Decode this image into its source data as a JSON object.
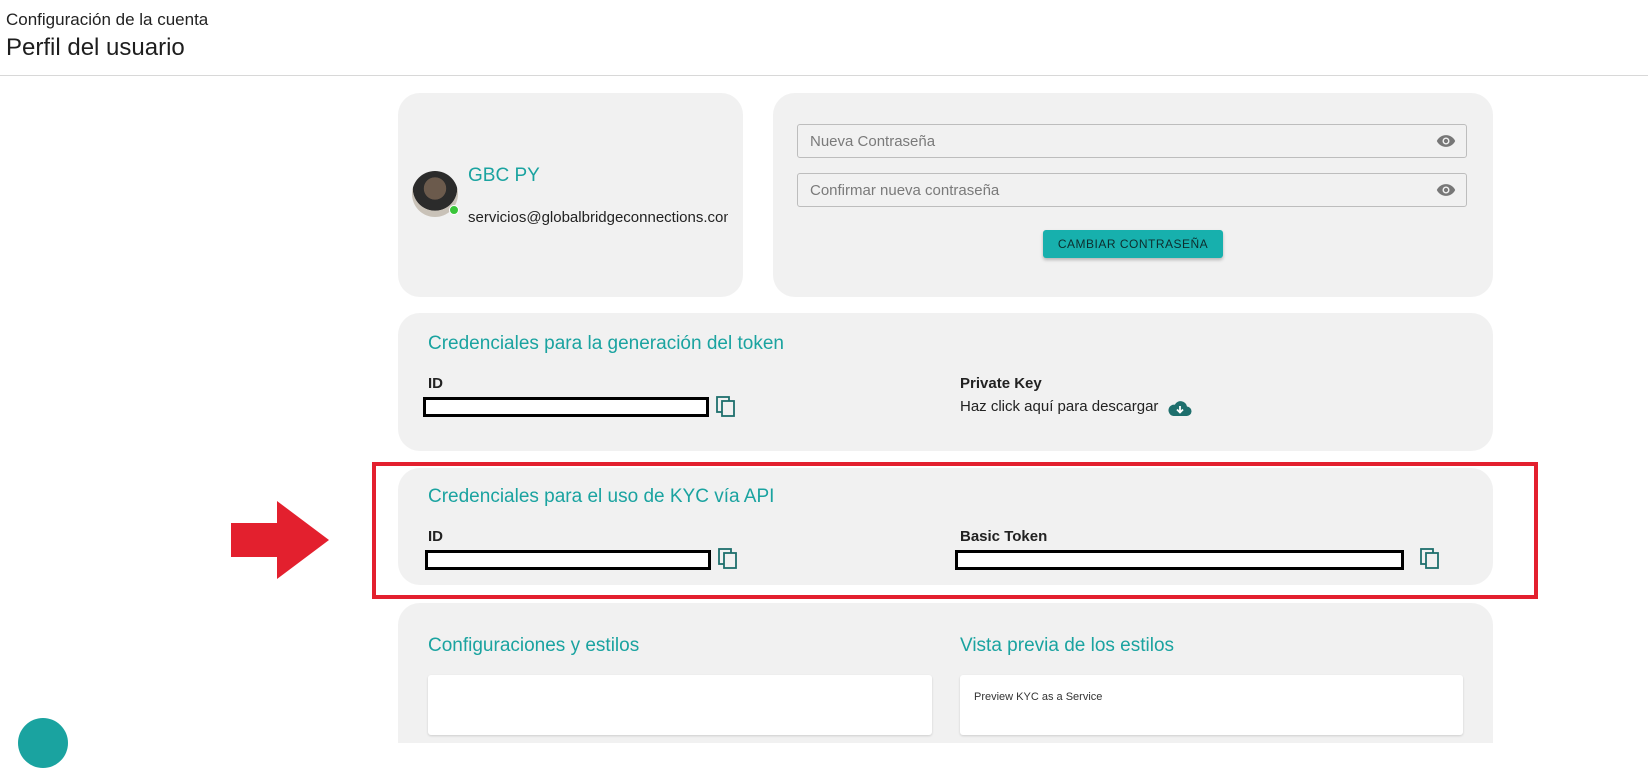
{
  "header": {
    "subtitle": "Configuración de la cuenta",
    "title": "Perfil del usuario"
  },
  "profile": {
    "name": "GBC PY",
    "email": "servicios@globalbridgeconnections.com",
    "status_color": "#3ac53a"
  },
  "password": {
    "new_placeholder": "Nueva Contraseña",
    "confirm_placeholder": "Confirmar nueva contraseña",
    "change_button": "CAMBIAR CONTRASEÑA",
    "visibility_icon": "eye-icon"
  },
  "token_credentials": {
    "title": "Credenciales para la generación del token",
    "id_label": "ID",
    "private_key_label": "Private Key",
    "download_text": "Haz click aquí para descargar",
    "download_icon": "cloud-download-icon",
    "copy_icon": "copy-icon"
  },
  "kyc_credentials": {
    "title": "Credenciales para el uso de KYC vía API",
    "id_label": "ID",
    "basic_token_label": "Basic Token",
    "copy_icon": "copy-icon"
  },
  "config": {
    "title": "Configuraciones y estilos",
    "preview_title": "Vista previa de los estilos",
    "preview_text": "Preview KYC as a Service"
  },
  "colors": {
    "accent": "#1aa3a0",
    "button": "#17b0ad",
    "card_bg": "#f1f1f1",
    "highlight": "#e3202e"
  }
}
